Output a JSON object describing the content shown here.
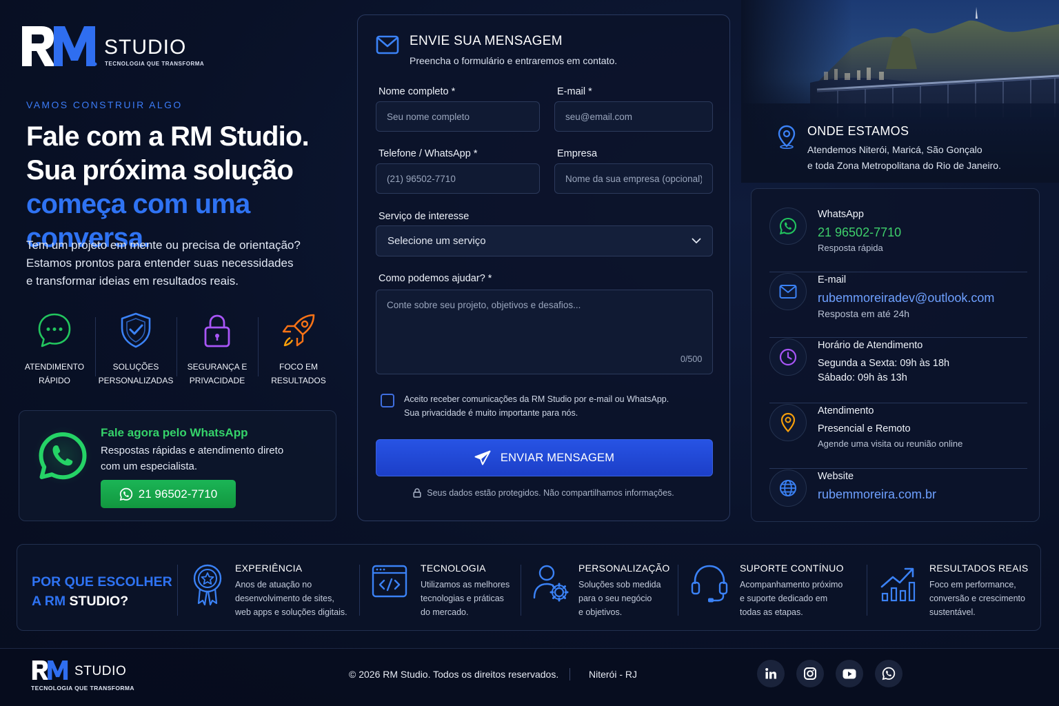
{
  "brand": {
    "logo_mark": "RM",
    "name": "STUDIO",
    "tagline": "TECNOLOGIA QUE TRANSFORMA"
  },
  "hero": {
    "eyebrow": "VAMOS CONSTRUIR ALGO",
    "headline_line1": "Fale com a RM Studio.",
    "headline_line2": "Sua próxima solução",
    "headline_accent": "começa com uma conversa.",
    "intro_line1": "Tem um projeto em mente ou precisa de orientação?",
    "intro_line2": "Estamos prontos para entender suas necessidades",
    "intro_line3": "e transformar ideias em resultados reais."
  },
  "features": [
    {
      "icon": "chat-bubble-icon",
      "line1": "ATENDIMENTO",
      "line2": "RÁPIDO",
      "color": "#22c55e"
    },
    {
      "icon": "shield-check-icon",
      "line1": "SOLUÇÕES",
      "line2": "PERSONALIZADAS",
      "color": "#3b82f6"
    },
    {
      "icon": "padlock-icon",
      "line1": "SEGURANÇA E",
      "line2": "PRIVACIDADE",
      "color": "#a855f7"
    },
    {
      "icon": "rocket-icon",
      "line1": "FOCO EM",
      "line2": "RESULTADOS",
      "color": "#f97316"
    }
  ],
  "whatsapp_card": {
    "title": "Fale agora pelo WhatsApp",
    "desc_line1": "Respostas rápidas e atendimento direto",
    "desc_line2": "com um especialista.",
    "button_label": "21 96502-7710",
    "color": "#22c55e"
  },
  "form": {
    "title": "ENVIE SUA MENSAGEM",
    "subtitle": "Preencha o formulário e entraremos em contato.",
    "name_label": "Nome completo *",
    "name_placeholder": "Seu nome completo",
    "email_label": "E-mail *",
    "email_placeholder": "seu@email.com",
    "phone_label": "Telefone / WhatsApp *",
    "phone_placeholder": "(21) 96502-7710",
    "company_label": "Empresa",
    "company_placeholder": "Nome da sua empresa (opcional)",
    "service_label": "Serviço de interesse",
    "service_selected": "Selecione um serviço",
    "message_label": "Como podemos ajudar? *",
    "message_placeholder": "Conte sobre seu projeto, objetivos e desafios...",
    "message_counter": "0/500",
    "consent_line1": "Aceito receber comunicações da RM Studio por e-mail ou WhatsApp.",
    "consent_line2": "Sua privacidade é muito importante para nós.",
    "submit_label": "ENVIAR MENSAGEM",
    "security_note": "Seus dados estão protegidos. Não compartilhamos informações.",
    "accent_color": "#2753e4"
  },
  "location": {
    "title": "ONDE ESTAMOS",
    "text_line1": "Atendemos Niterói, Maricá, São Gonçalo",
    "text_line2": "e toda Zona Metropolitana do Rio de Janeiro."
  },
  "contacts": [
    {
      "icon": "whatsapp-icon",
      "label": "WhatsApp",
      "value": "21 96502-7710",
      "sub": "Resposta rápida",
      "color": "#22c55e"
    },
    {
      "icon": "envelope-icon",
      "label": "E-mail",
      "value": "rubemmoreiradev@outlook.com",
      "sub": "Resposta em até 24h",
      "color": "#3b82f6"
    },
    {
      "icon": "clock-icon",
      "label": "Horário de Atendimento",
      "value": "Segunda a Sexta: 09h às 18h",
      "sub": "Sábado: 09h às 13h",
      "color": "#a855f7"
    },
    {
      "icon": "map-pin-icon",
      "label": "Atendimento",
      "value": "Presencial e Remoto",
      "sub": "Agende uma visita ou reunião online",
      "color": "#f59e0b"
    },
    {
      "icon": "globe-icon",
      "label": "Website",
      "value": "rubemmoreira.com.br",
      "sub": "",
      "color": "#3b82f6"
    }
  ],
  "why": {
    "title_line1": "POR QUE ESCOLHER",
    "title_rm": "A RM",
    "title_studio": "STUDIO?",
    "items": [
      {
        "icon": "award-medal-icon",
        "title": "EXPERIÊNCIA",
        "d1": "Anos de atuação no",
        "d2": "desenvolvimento de sites,",
        "d3": "web apps e soluções digitais."
      },
      {
        "icon": "code-window-icon",
        "title": "TECNOLOGIA",
        "d1": "Utilizamos as melhores",
        "d2": "tecnologias e práticas",
        "d3": "do mercado."
      },
      {
        "icon": "user-gear-icon",
        "title": "PERSONALIZAÇÃO",
        "d1": "Soluções sob medida",
        "d2": "para o seu negócio",
        "d3": "e objetivos."
      },
      {
        "icon": "headset-icon",
        "title": "SUPORTE CONTÍNUO",
        "d1": "Acompanhamento próximo",
        "d2": "e suporte dedicado em",
        "d3": "todas as etapas."
      },
      {
        "icon": "growth-chart-icon",
        "title": "RESULTADOS REAIS",
        "d1": "Foco em performance,",
        "d2": "conversão e crescimento",
        "d3": "sustentável."
      }
    ]
  },
  "footer": {
    "logo_mark": "RM",
    "name": "STUDIO",
    "tagline": "TECNOLOGIA QUE TRANSFORMA",
    "copyright": "© 2026 RM Studio. Todos os direitos reservados.",
    "city": "Niterói - RJ",
    "socials": [
      "linkedin-icon",
      "instagram-icon",
      "youtube-icon",
      "whatsapp-icon"
    ]
  }
}
